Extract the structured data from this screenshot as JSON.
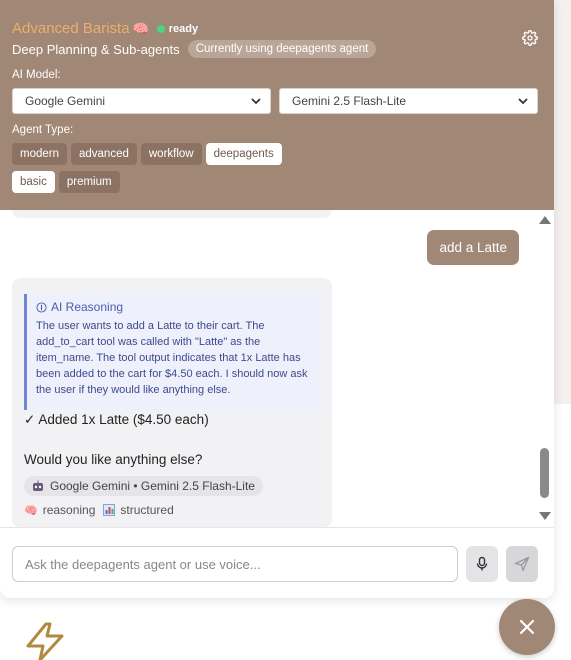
{
  "colors": {
    "header_bg": "#a18776",
    "title_accent": "#e8b06a",
    "status_green": "#4cd67a",
    "chip_bg": "#8c7263",
    "chip_active_bg": "#ffffff",
    "reasoning_accent": "#6f86d6",
    "bot_bubble_bg": "#f2f2f4"
  },
  "header": {
    "title": "Advanced Barista",
    "title_icon": "brain-icon",
    "status": "ready",
    "settings_icon": "gear-icon",
    "subtitle": "Deep Planning & Sub-agents",
    "current_agent_badge": "Currently using deepagents agent",
    "model_label": "AI Model:",
    "provider_select": {
      "value": "Google Gemini"
    },
    "model_select": {
      "value": "Gemini 2.5 Flash-Lite"
    },
    "agent_type_label": "Agent Type:",
    "agent_types": [
      {
        "label": "modern",
        "active": false
      },
      {
        "label": "advanced",
        "active": false
      },
      {
        "label": "workflow",
        "active": false
      },
      {
        "label": "deepagents",
        "active": true
      },
      {
        "label": "basic",
        "active": true
      },
      {
        "label": "premium",
        "active": false
      }
    ]
  },
  "messages": {
    "user_message": "add a Latte",
    "bot": {
      "reasoning_title": "AI Reasoning",
      "reasoning_text": "The user wants to add a Latte to their cart. The add_to_cart tool was called with \"Latte\" as the item_name. The tool output indicates that 1x Latte has been added to the cart for $4.50 each. I should now ask the user if they would like anything else.",
      "confirmation": "✓ Added 1x Latte ($4.50 each)",
      "question": "Would you like anything else?",
      "model_badge": "Google Gemini • Gemini 2.5 Flash-Lite",
      "tags": [
        {
          "icon": "brain-icon",
          "label": "reasoning"
        },
        {
          "icon": "bar-chart-icon",
          "label": "structured"
        }
      ]
    }
  },
  "input": {
    "placeholder": "Ask the deepagents agent or use voice...",
    "value": "",
    "mic_icon": "microphone-icon",
    "send_icon": "send-icon"
  },
  "fab": {
    "icon": "close-icon"
  },
  "page": {
    "logo_icon": "lightning-bolt-icon"
  }
}
